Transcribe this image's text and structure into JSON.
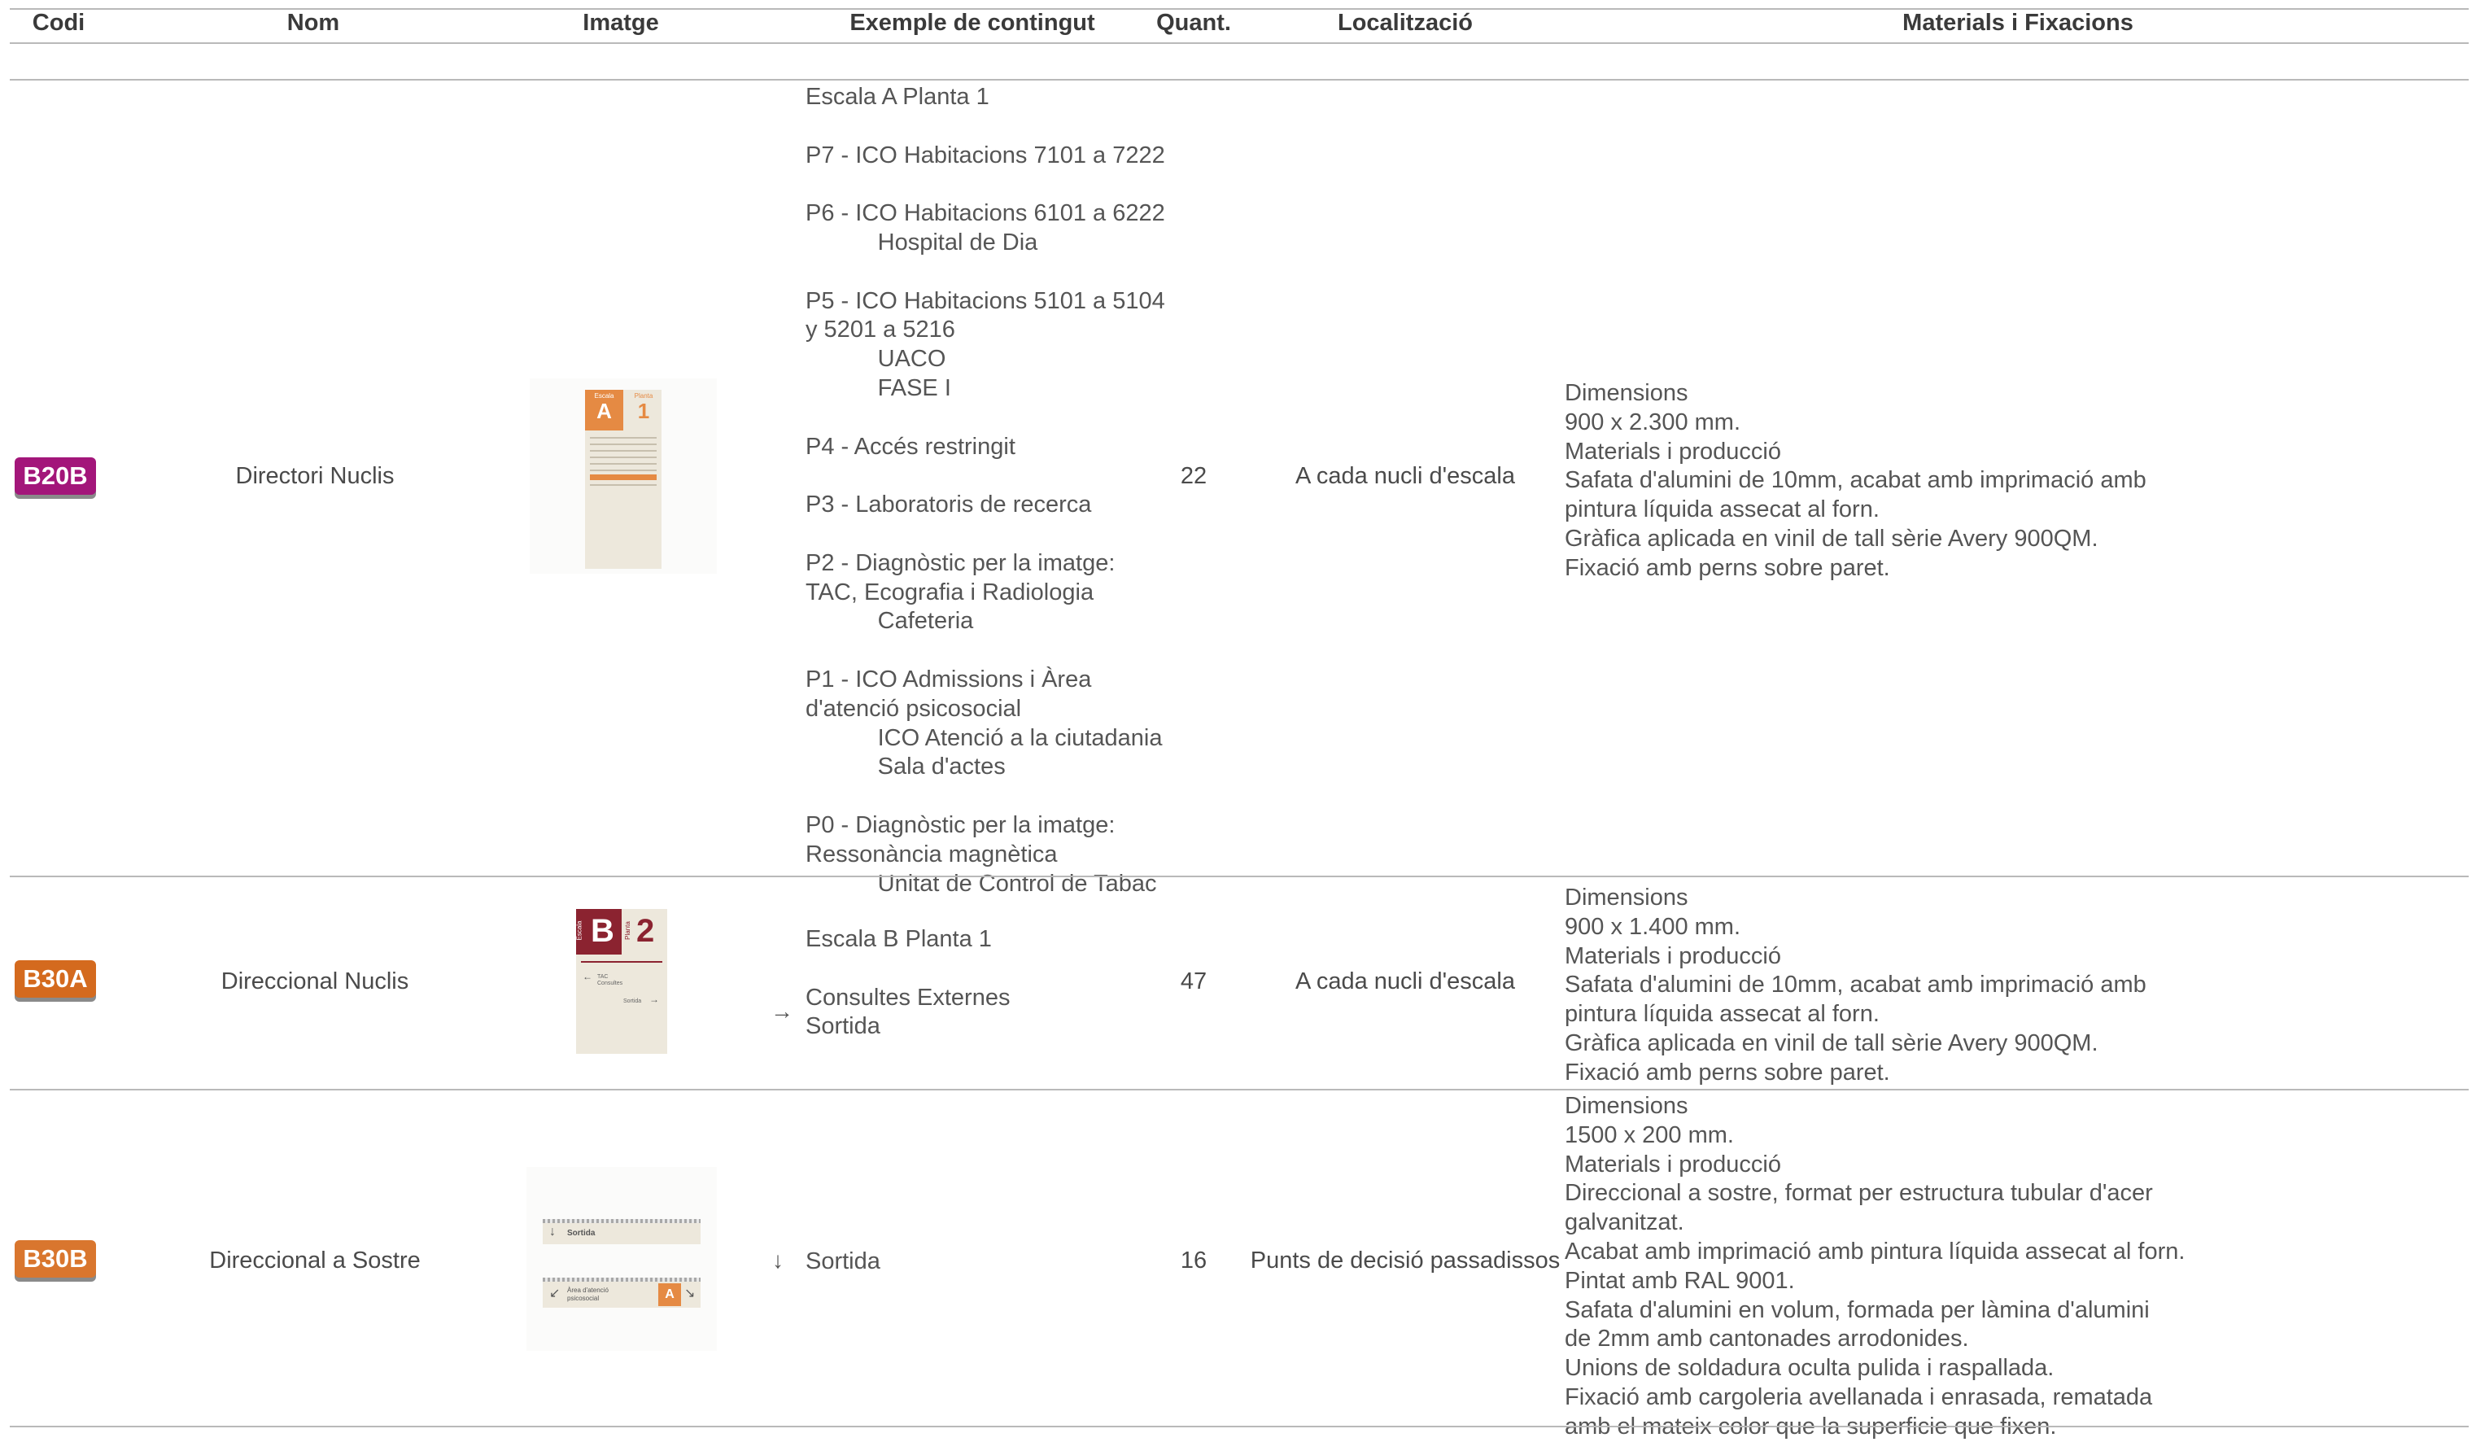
{
  "header": {
    "codi": "Codi",
    "nom": "Nom",
    "imatge": "Imatge",
    "exemple": "Exemple de contingut",
    "quant": "Quant.",
    "localitzacio": "Localització",
    "materials": "Materials i Fixacions"
  },
  "colors": {
    "b20b": "#a3167a",
    "b30a": "#d46a1e",
    "b30b": "#d9762e",
    "thumb_accent": "#e58a43",
    "thumb_maroon": "#8b2330"
  },
  "rows": [
    {
      "code": "B20B",
      "name": "Directori Nuclis",
      "qty": "22",
      "location": "A cada nucli d'escala",
      "content": "Escala A Planta 1\n\nP7 - ICO Habitacions 7101 a 7222\n\nP6 - ICO Habitacions 6101 a 6222\n           Hospital de Dia\n\nP5 - ICO Habitacions 5101 a 5104\ny 5201 a 5216\n           UACO\n           FASE I\n\nP4 - Accés restringit\n\nP3 - Laboratoris de recerca\n\nP2 - Diagnòstic per la imatge:\nTAC, Ecografia i Radiologia\n           Cafeteria\n\nP1 - ICO Admissions i Àrea\nd'atenció psicosocial\n           ICO Atenció a la ciutadania\n           Sala d'actes\n\nP0 - Diagnòstic per la imatge:\nRessonància magnètica\n           Unitat de Control de Tabac",
      "materials": "Dimensions\n900 x 2.300 mm.\nMaterials i producció\nSafata d'alumini de 10mm, acabat amb imprimació amb\npintura líquida assecat al forn.\nGràfica aplicada en vinil de tall sèrie Avery 900QM.\nFixació amb perns sobre paret.",
      "thumb": {
        "escala_label": "Escala",
        "escala_letter": "A",
        "planta_label": "Planta",
        "planta_number": "1"
      }
    },
    {
      "code": "B30A",
      "name": "Direccional Nuclis",
      "qty": "47",
      "location": "A cada nucli d'escala",
      "content": "Escala B Planta 1\n\nConsultes Externes\nSortida",
      "content_arrow": "→",
      "materials": "Dimensions\n900 x 1.400 mm.\nMaterials i producció\nSafata d'alumini de 10mm, acabat amb imprimació amb\npintura líquida assecat al forn.\nGràfica aplicada en vinil de tall sèrie Avery 900QM.\nFixació amb perns sobre paret.",
      "thumb": {
        "escala_label": "Escala",
        "escala_letter": "B",
        "planta_label": "Planta",
        "planta_number": "2",
        "line1": "TAC",
        "line2": "Consultes",
        "line3": "Sortida"
      }
    },
    {
      "code": "B30B",
      "name": "Direccional a Sostre",
      "qty": "16",
      "location": "Punts de decisió passadissos",
      "content": "Sortida",
      "content_arrow": "↓",
      "materials": "Dimensions\n1500 x 200 mm.\nMaterials i producció\nDireccional a sostre, format per estructura tubular d'acer\ngalvanitzat.\nAcabat amb imprimació amb pintura líquida assecat al forn.\nPintat amb RAL 9001.\nSafata d'alumini en volum, formada per làmina d'alumini\nde 2mm amb cantonades arrodonides.\nUnions de soldadura oculta pulida i raspallada.\nFixació amb cargoleria avellanada i enrasada, rematada\namb el mateix color que la superficie que fixen.",
      "thumb": {
        "sign1": "Sortida",
        "sign2": "Àrea d'atenció psicosocial",
        "sign2_letter": "A"
      }
    }
  ]
}
